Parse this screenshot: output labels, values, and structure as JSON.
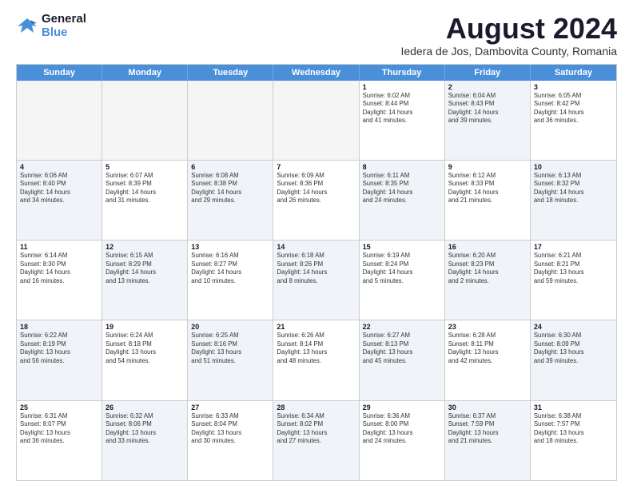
{
  "logo": {
    "line1": "General",
    "line2": "Blue"
  },
  "title": "August 2024",
  "subtitle": "Iedera de Jos, Dambovita County, Romania",
  "calendar": {
    "headers": [
      "Sunday",
      "Monday",
      "Tuesday",
      "Wednesday",
      "Thursday",
      "Friday",
      "Saturday"
    ],
    "rows": [
      [
        {
          "day": "",
          "empty": true
        },
        {
          "day": "",
          "empty": true
        },
        {
          "day": "",
          "empty": true
        },
        {
          "day": "",
          "empty": true
        },
        {
          "day": "1",
          "line1": "Sunrise: 6:02 AM",
          "line2": "Sunset: 8:44 PM",
          "line3": "Daylight: 14 hours",
          "line4": "and 41 minutes."
        },
        {
          "day": "2",
          "line1": "Sunrise: 6:04 AM",
          "line2": "Sunset: 8:43 PM",
          "line3": "Daylight: 14 hours",
          "line4": "and 39 minutes.",
          "shaded": true
        },
        {
          "day": "3",
          "line1": "Sunrise: 6:05 AM",
          "line2": "Sunset: 8:42 PM",
          "line3": "Daylight: 14 hours",
          "line4": "and 36 minutes."
        }
      ],
      [
        {
          "day": "4",
          "line1": "Sunrise: 6:06 AM",
          "line2": "Sunset: 8:40 PM",
          "line3": "Daylight: 14 hours",
          "line4": "and 34 minutes.",
          "shaded": true
        },
        {
          "day": "5",
          "line1": "Sunrise: 6:07 AM",
          "line2": "Sunset: 8:39 PM",
          "line3": "Daylight: 14 hours",
          "line4": "and 31 minutes."
        },
        {
          "day": "6",
          "line1": "Sunrise: 6:08 AM",
          "line2": "Sunset: 8:38 PM",
          "line3": "Daylight: 14 hours",
          "line4": "and 29 minutes.",
          "shaded": true
        },
        {
          "day": "7",
          "line1": "Sunrise: 6:09 AM",
          "line2": "Sunset: 8:36 PM",
          "line3": "Daylight: 14 hours",
          "line4": "and 26 minutes."
        },
        {
          "day": "8",
          "line1": "Sunrise: 6:11 AM",
          "line2": "Sunset: 8:35 PM",
          "line3": "Daylight: 14 hours",
          "line4": "and 24 minutes.",
          "shaded": true
        },
        {
          "day": "9",
          "line1": "Sunrise: 6:12 AM",
          "line2": "Sunset: 8:33 PM",
          "line3": "Daylight: 14 hours",
          "line4": "and 21 minutes."
        },
        {
          "day": "10",
          "line1": "Sunrise: 6:13 AM",
          "line2": "Sunset: 8:32 PM",
          "line3": "Daylight: 14 hours",
          "line4": "and 18 minutes.",
          "shaded": true
        }
      ],
      [
        {
          "day": "11",
          "line1": "Sunrise: 6:14 AM",
          "line2": "Sunset: 8:30 PM",
          "line3": "Daylight: 14 hours",
          "line4": "and 16 minutes."
        },
        {
          "day": "12",
          "line1": "Sunrise: 6:15 AM",
          "line2": "Sunset: 8:29 PM",
          "line3": "Daylight: 14 hours",
          "line4": "and 13 minutes.",
          "shaded": true
        },
        {
          "day": "13",
          "line1": "Sunrise: 6:16 AM",
          "line2": "Sunset: 8:27 PM",
          "line3": "Daylight: 14 hours",
          "line4": "and 10 minutes."
        },
        {
          "day": "14",
          "line1": "Sunrise: 6:18 AM",
          "line2": "Sunset: 8:26 PM",
          "line3": "Daylight: 14 hours",
          "line4": "and 8 minutes.",
          "shaded": true
        },
        {
          "day": "15",
          "line1": "Sunrise: 6:19 AM",
          "line2": "Sunset: 8:24 PM",
          "line3": "Daylight: 14 hours",
          "line4": "and 5 minutes."
        },
        {
          "day": "16",
          "line1": "Sunrise: 6:20 AM",
          "line2": "Sunset: 8:23 PM",
          "line3": "Daylight: 14 hours",
          "line4": "and 2 minutes.",
          "shaded": true
        },
        {
          "day": "17",
          "line1": "Sunrise: 6:21 AM",
          "line2": "Sunset: 8:21 PM",
          "line3": "Daylight: 13 hours",
          "line4": "and 59 minutes."
        }
      ],
      [
        {
          "day": "18",
          "line1": "Sunrise: 6:22 AM",
          "line2": "Sunset: 8:19 PM",
          "line3": "Daylight: 13 hours",
          "line4": "and 56 minutes.",
          "shaded": true
        },
        {
          "day": "19",
          "line1": "Sunrise: 6:24 AM",
          "line2": "Sunset: 8:18 PM",
          "line3": "Daylight: 13 hours",
          "line4": "and 54 minutes."
        },
        {
          "day": "20",
          "line1": "Sunrise: 6:25 AM",
          "line2": "Sunset: 8:16 PM",
          "line3": "Daylight: 13 hours",
          "line4": "and 51 minutes.",
          "shaded": true
        },
        {
          "day": "21",
          "line1": "Sunrise: 6:26 AM",
          "line2": "Sunset: 8:14 PM",
          "line3": "Daylight: 13 hours",
          "line4": "and 48 minutes."
        },
        {
          "day": "22",
          "line1": "Sunrise: 6:27 AM",
          "line2": "Sunset: 8:13 PM",
          "line3": "Daylight: 13 hours",
          "line4": "and 45 minutes.",
          "shaded": true
        },
        {
          "day": "23",
          "line1": "Sunrise: 6:28 AM",
          "line2": "Sunset: 8:11 PM",
          "line3": "Daylight: 13 hours",
          "line4": "and 42 minutes."
        },
        {
          "day": "24",
          "line1": "Sunrise: 6:30 AM",
          "line2": "Sunset: 8:09 PM",
          "line3": "Daylight: 13 hours",
          "line4": "and 39 minutes.",
          "shaded": true
        }
      ],
      [
        {
          "day": "25",
          "line1": "Sunrise: 6:31 AM",
          "line2": "Sunset: 8:07 PM",
          "line3": "Daylight: 13 hours",
          "line4": "and 36 minutes."
        },
        {
          "day": "26",
          "line1": "Sunrise: 6:32 AM",
          "line2": "Sunset: 8:06 PM",
          "line3": "Daylight: 13 hours",
          "line4": "and 33 minutes.",
          "shaded": true
        },
        {
          "day": "27",
          "line1": "Sunrise: 6:33 AM",
          "line2": "Sunset: 8:04 PM",
          "line3": "Daylight: 13 hours",
          "line4": "and 30 minutes."
        },
        {
          "day": "28",
          "line1": "Sunrise: 6:34 AM",
          "line2": "Sunset: 8:02 PM",
          "line3": "Daylight: 13 hours",
          "line4": "and 27 minutes.",
          "shaded": true
        },
        {
          "day": "29",
          "line1": "Sunrise: 6:36 AM",
          "line2": "Sunset: 8:00 PM",
          "line3": "Daylight: 13 hours",
          "line4": "and 24 minutes."
        },
        {
          "day": "30",
          "line1": "Sunrise: 6:37 AM",
          "line2": "Sunset: 7:59 PM",
          "line3": "Daylight: 13 hours",
          "line4": "and 21 minutes.",
          "shaded": true
        },
        {
          "day": "31",
          "line1": "Sunrise: 6:38 AM",
          "line2": "Sunset: 7:57 PM",
          "line3": "Daylight: 13 hours",
          "line4": "and 18 minutes."
        }
      ]
    ]
  }
}
